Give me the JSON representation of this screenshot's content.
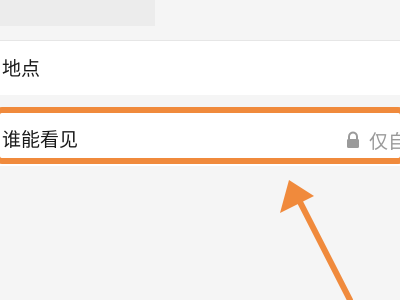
{
  "form": {
    "location_label": "地点",
    "visibility_label": "谁能看见",
    "visibility_value": "仅自"
  },
  "annotation": {
    "color": "#f08a3c"
  },
  "icons": {
    "visibility": "lock-icon"
  }
}
